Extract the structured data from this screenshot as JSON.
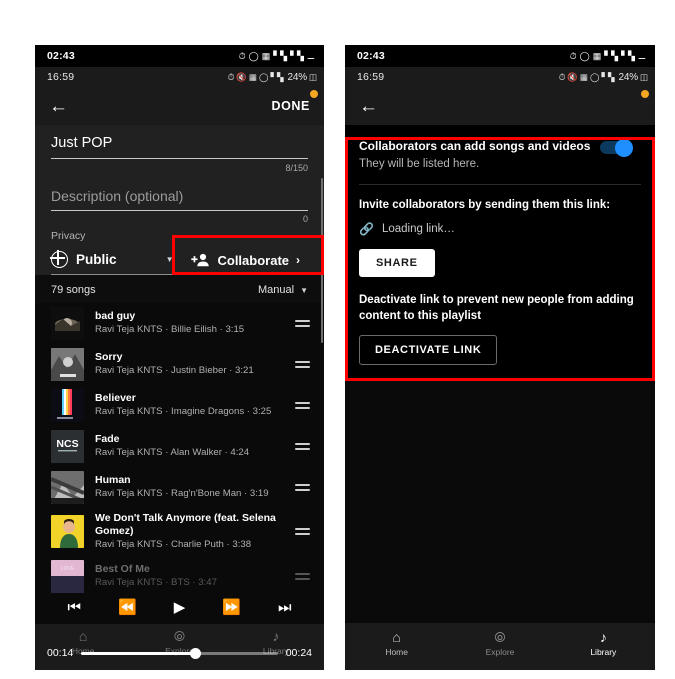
{
  "left_phone": {
    "system_status": {
      "time": "02:43",
      "icons": [
        "alarm-icon",
        "wifi-icon",
        "vibrate-icon",
        "signal-1-icon",
        "signal-2-icon",
        "battery-saver-icon"
      ]
    },
    "app_status": {
      "time": "16:59",
      "icons": [
        "alarm-icon",
        "mute-icon",
        "vibrate-icon",
        "wifi-icon",
        "signal-icon"
      ],
      "battery": "24%"
    },
    "navbar": {
      "back_icon": "back-arrow-icon",
      "done_label": "DONE",
      "dot_color": "#f5a623"
    },
    "editor": {
      "title_value": "Just POP",
      "title_counter": "8/150",
      "description_placeholder": "Description (optional)",
      "description_counter": "0",
      "privacy_label": "Privacy",
      "privacy_value": "Public",
      "privacy_icon": "globe-icon",
      "collaborate_label": "Collaborate",
      "collaborate_icon": "add-person-icon",
      "collaborate_chevron": "›"
    },
    "list": {
      "count_label": "79 songs",
      "sort_label": "Manual",
      "songs": [
        {
          "title": "bad guy",
          "subtitle": "Ravi Teja KNTS · Billie Eilish · 3:15",
          "art": "badguy"
        },
        {
          "title": "Sorry",
          "subtitle": "Ravi Teja KNTS · Justin Bieber · 3:21",
          "art": "sorry"
        },
        {
          "title": "Believer",
          "subtitle": "Ravi Teja KNTS · Imagine Dragons · 3:25",
          "art": "believer"
        },
        {
          "title": "Fade",
          "subtitle": "Ravi Teja KNTS · Alan Walker · 4:24",
          "art": "ncs"
        },
        {
          "title": "Human",
          "subtitle": "Ravi Teja KNTS · Rag'n'Bone Man · 3:19",
          "art": "human"
        },
        {
          "title": "We Don't Talk Anymore (feat. Selena Gomez)",
          "subtitle": "Ravi Teja KNTS · Charlie Puth · 3:38",
          "art": "wedont"
        },
        {
          "title": "Best Of Me",
          "subtitle": "Ravi Teja KNTS · BTS · 3:47",
          "art": "bts"
        }
      ]
    },
    "player": {
      "prev_icon": "skip-to-start-icon",
      "rewind_icon": "rewind-icon",
      "play_icon": "play-icon",
      "forward_icon": "fast-forward-icon",
      "next_icon": "skip-to-end-icon",
      "elapsed": "00:14",
      "duration": "00:24",
      "progress_percent": 58
    },
    "bottom_nav": [
      {
        "label": "Home",
        "icon": "home-icon"
      },
      {
        "label": "Explore",
        "icon": "compass-icon"
      },
      {
        "label": "Library",
        "icon": "library-icon"
      }
    ]
  },
  "right_phone": {
    "system_status": {
      "time": "02:43",
      "icons": [
        "alarm-icon",
        "wifi-icon",
        "vibrate-icon",
        "signal-1-icon",
        "signal-2-icon",
        "battery-saver-icon"
      ]
    },
    "app_status": {
      "time": "16:59",
      "icons": [
        "alarm-icon",
        "mute-icon",
        "vibrate-icon",
        "wifi-icon",
        "signal-icon"
      ],
      "battery": "24%"
    },
    "navbar": {
      "back_icon": "back-arrow-icon",
      "dot_color": "#f5a623"
    },
    "collaborate_panel": {
      "heading": "Collaborators can add songs and videos",
      "subtext": "They will be listed here.",
      "toggle_on": true,
      "toggle_color": "#1f8fff",
      "invite_heading": "Invite collaborators by sending them this link:",
      "link_icon": "link-icon",
      "link_text": "Loading link…",
      "share_label": "SHARE",
      "deactivate_text": "Deactivate link to prevent new people from adding content to this playlist",
      "deactivate_label": "DEACTIVATE LINK"
    },
    "bottom_nav": [
      {
        "label": "Home",
        "icon": "home-icon"
      },
      {
        "label": "Explore",
        "icon": "compass-icon"
      },
      {
        "label": "Library",
        "icon": "library-icon"
      }
    ]
  },
  "annotations": {
    "color": "#ff0000",
    "boxes": [
      "collaborate-button",
      "collaborate-panel"
    ]
  }
}
